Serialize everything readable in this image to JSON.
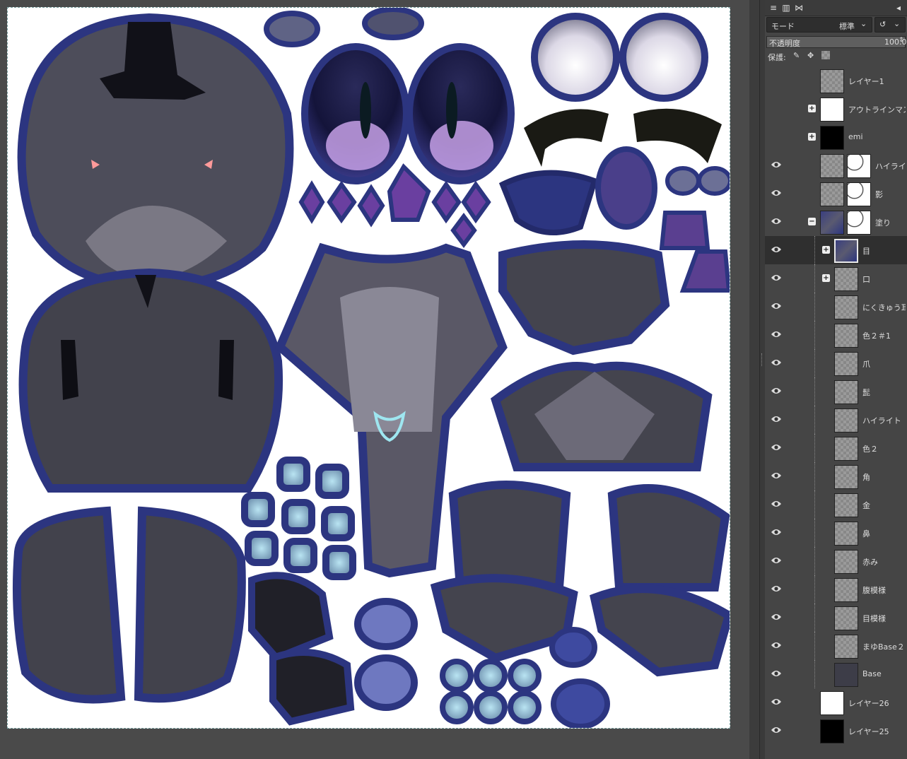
{
  "panel": {
    "mode_label": "モード",
    "mode_value": "標準",
    "opacity_label": "不透明度",
    "opacity_value": "100.0",
    "lock_label": "保護:"
  },
  "layers": [
    {
      "name": "レイヤー1",
      "visible": false,
      "indent": 0,
      "expander": "",
      "thumb": "checker"
    },
    {
      "name": "アウトラインマスク",
      "visible": false,
      "indent": 0,
      "expander": "+",
      "thumb": "white"
    },
    {
      "name": "emi",
      "visible": false,
      "indent": 0,
      "expander": "+",
      "thumb": "black"
    },
    {
      "name": "ハイライト",
      "visible": true,
      "indent": 0,
      "expander": "",
      "thumb": "checker",
      "mask": true
    },
    {
      "name": "影",
      "visible": true,
      "indent": 0,
      "expander": "",
      "thumb": "checker",
      "mask": true
    },
    {
      "name": "塗り",
      "visible": true,
      "indent": 0,
      "expander": "−",
      "thumb": "texture",
      "mask": true
    },
    {
      "name": "目",
      "visible": true,
      "indent": 1,
      "expander": "+",
      "thumb": "texture",
      "selected": true
    },
    {
      "name": "口",
      "visible": true,
      "indent": 1,
      "expander": "+",
      "thumb": "checker"
    },
    {
      "name": "にくきゅう耳",
      "visible": true,
      "indent": 1,
      "expander": "",
      "thumb": "checker"
    },
    {
      "name": "色２＃1",
      "visible": true,
      "indent": 1,
      "expander": "",
      "thumb": "checker"
    },
    {
      "name": "爪",
      "visible": true,
      "indent": 1,
      "expander": "",
      "thumb": "checker"
    },
    {
      "name": "髭",
      "visible": true,
      "indent": 1,
      "expander": "",
      "thumb": "checker"
    },
    {
      "name": "ハイライト",
      "visible": true,
      "indent": 1,
      "expander": "",
      "thumb": "checker"
    },
    {
      "name": "色２",
      "visible": true,
      "indent": 1,
      "expander": "",
      "thumb": "checker"
    },
    {
      "name": "角",
      "visible": true,
      "indent": 1,
      "expander": "",
      "thumb": "checker"
    },
    {
      "name": "金",
      "visible": true,
      "indent": 1,
      "expander": "",
      "thumb": "checker"
    },
    {
      "name": "鼻",
      "visible": true,
      "indent": 1,
      "expander": "",
      "thumb": "checker"
    },
    {
      "name": "赤み",
      "visible": true,
      "indent": 1,
      "expander": "",
      "thumb": "checker"
    },
    {
      "name": "腹模様",
      "visible": true,
      "indent": 1,
      "expander": "",
      "thumb": "checker"
    },
    {
      "name": "目模様",
      "visible": true,
      "indent": 1,
      "expander": "",
      "thumb": "checker"
    },
    {
      "name": "まゆBase２",
      "visible": true,
      "indent": 1,
      "expander": "",
      "thumb": "checker"
    },
    {
      "name": "Base",
      "visible": true,
      "indent": 1,
      "expander": "",
      "thumb": "dark"
    },
    {
      "name": "レイヤー26",
      "visible": true,
      "indent": 0,
      "expander": "",
      "thumb": "white"
    },
    {
      "name": "レイヤー25",
      "visible": true,
      "indent": 0,
      "expander": "",
      "thumb": "black"
    }
  ]
}
